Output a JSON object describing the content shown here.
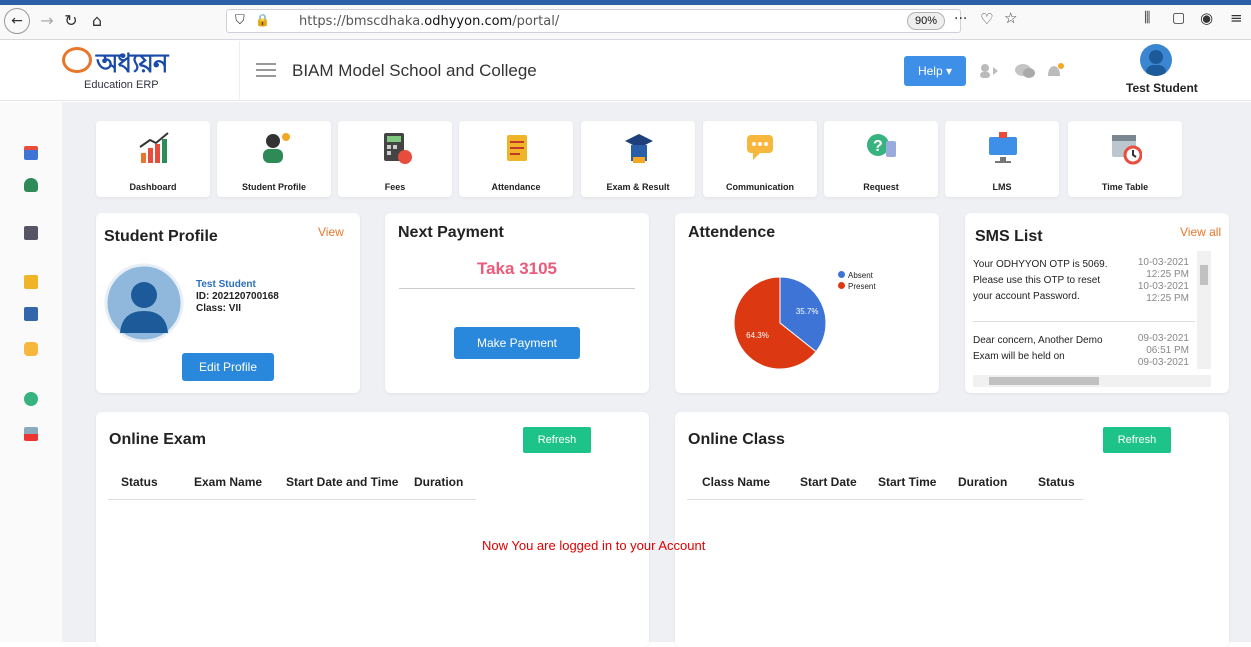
{
  "browser": {
    "url_prefix": "https://bmscdhaka.",
    "url_domain": "odhyyon.com",
    "url_suffix": "/portal/",
    "zoom": "90%"
  },
  "header": {
    "logo_text": "অধ্যয়ন",
    "logo_subtitle": "Education ERP",
    "school_name": "BIAM Model School and College",
    "help_label": "Help ▾",
    "user_name": "Test Student"
  },
  "modules": [
    {
      "label": "Dashboard"
    },
    {
      "label": "Student Profile"
    },
    {
      "label": "Fees"
    },
    {
      "label": "Attendance"
    },
    {
      "label": "Exam & Result"
    },
    {
      "label": "Communication"
    },
    {
      "label": "Request"
    },
    {
      "label": "LMS"
    },
    {
      "label": "Time Table"
    }
  ],
  "profile_card": {
    "title": "Student Profile",
    "view_link": "View",
    "name": "Test Student",
    "id": "ID: 202120700168",
    "class": "Class: VII",
    "edit_button": "Edit Profile"
  },
  "payment_card": {
    "title": "Next Payment",
    "amount": "Taka 3105",
    "button": "Make Payment"
  },
  "attendance_card": {
    "title": "Attendence",
    "legend": [
      {
        "label": "Absent",
        "color": "#3d74d6"
      },
      {
        "label": "Present",
        "color": "#dc3912"
      }
    ],
    "absent_label": "35.7%",
    "present_label": "64.3%"
  },
  "chart_data": {
    "type": "pie",
    "title": "Attendence",
    "slices": [
      {
        "label": "Absent",
        "value": 35.7,
        "color": "#3d74d6"
      },
      {
        "label": "Present",
        "value": 64.3,
        "color": "#dc3912"
      }
    ],
    "legend_position": "top-right"
  },
  "sms_card": {
    "title": "SMS List",
    "view_all": "View all",
    "messages": [
      {
        "lines": [
          "Your ODHYYON OTP is 5069.",
          "Please use this OTP to reset",
          "your account Password."
        ],
        "dates": [
          "10-03-2021",
          "12:25 PM",
          "10-03-2021",
          "12:25 PM"
        ]
      },
      {
        "lines": [
          "Dear concern, Another Demo",
          "Exam will be held on"
        ],
        "dates": [
          "09-03-2021",
          "06:51 PM",
          "09-03-2021"
        ]
      }
    ]
  },
  "online_exam": {
    "title": "Online Exam",
    "refresh": "Refresh",
    "columns": [
      "Status",
      "Exam Name",
      "Start Date and Time",
      "Duration"
    ]
  },
  "online_class": {
    "title": "Online Class",
    "refresh": "Refresh",
    "columns": [
      "Class Name",
      "Start Date",
      "Start Time",
      "Duration",
      "Status"
    ]
  },
  "notice": "Now You are logged in to your Account"
}
